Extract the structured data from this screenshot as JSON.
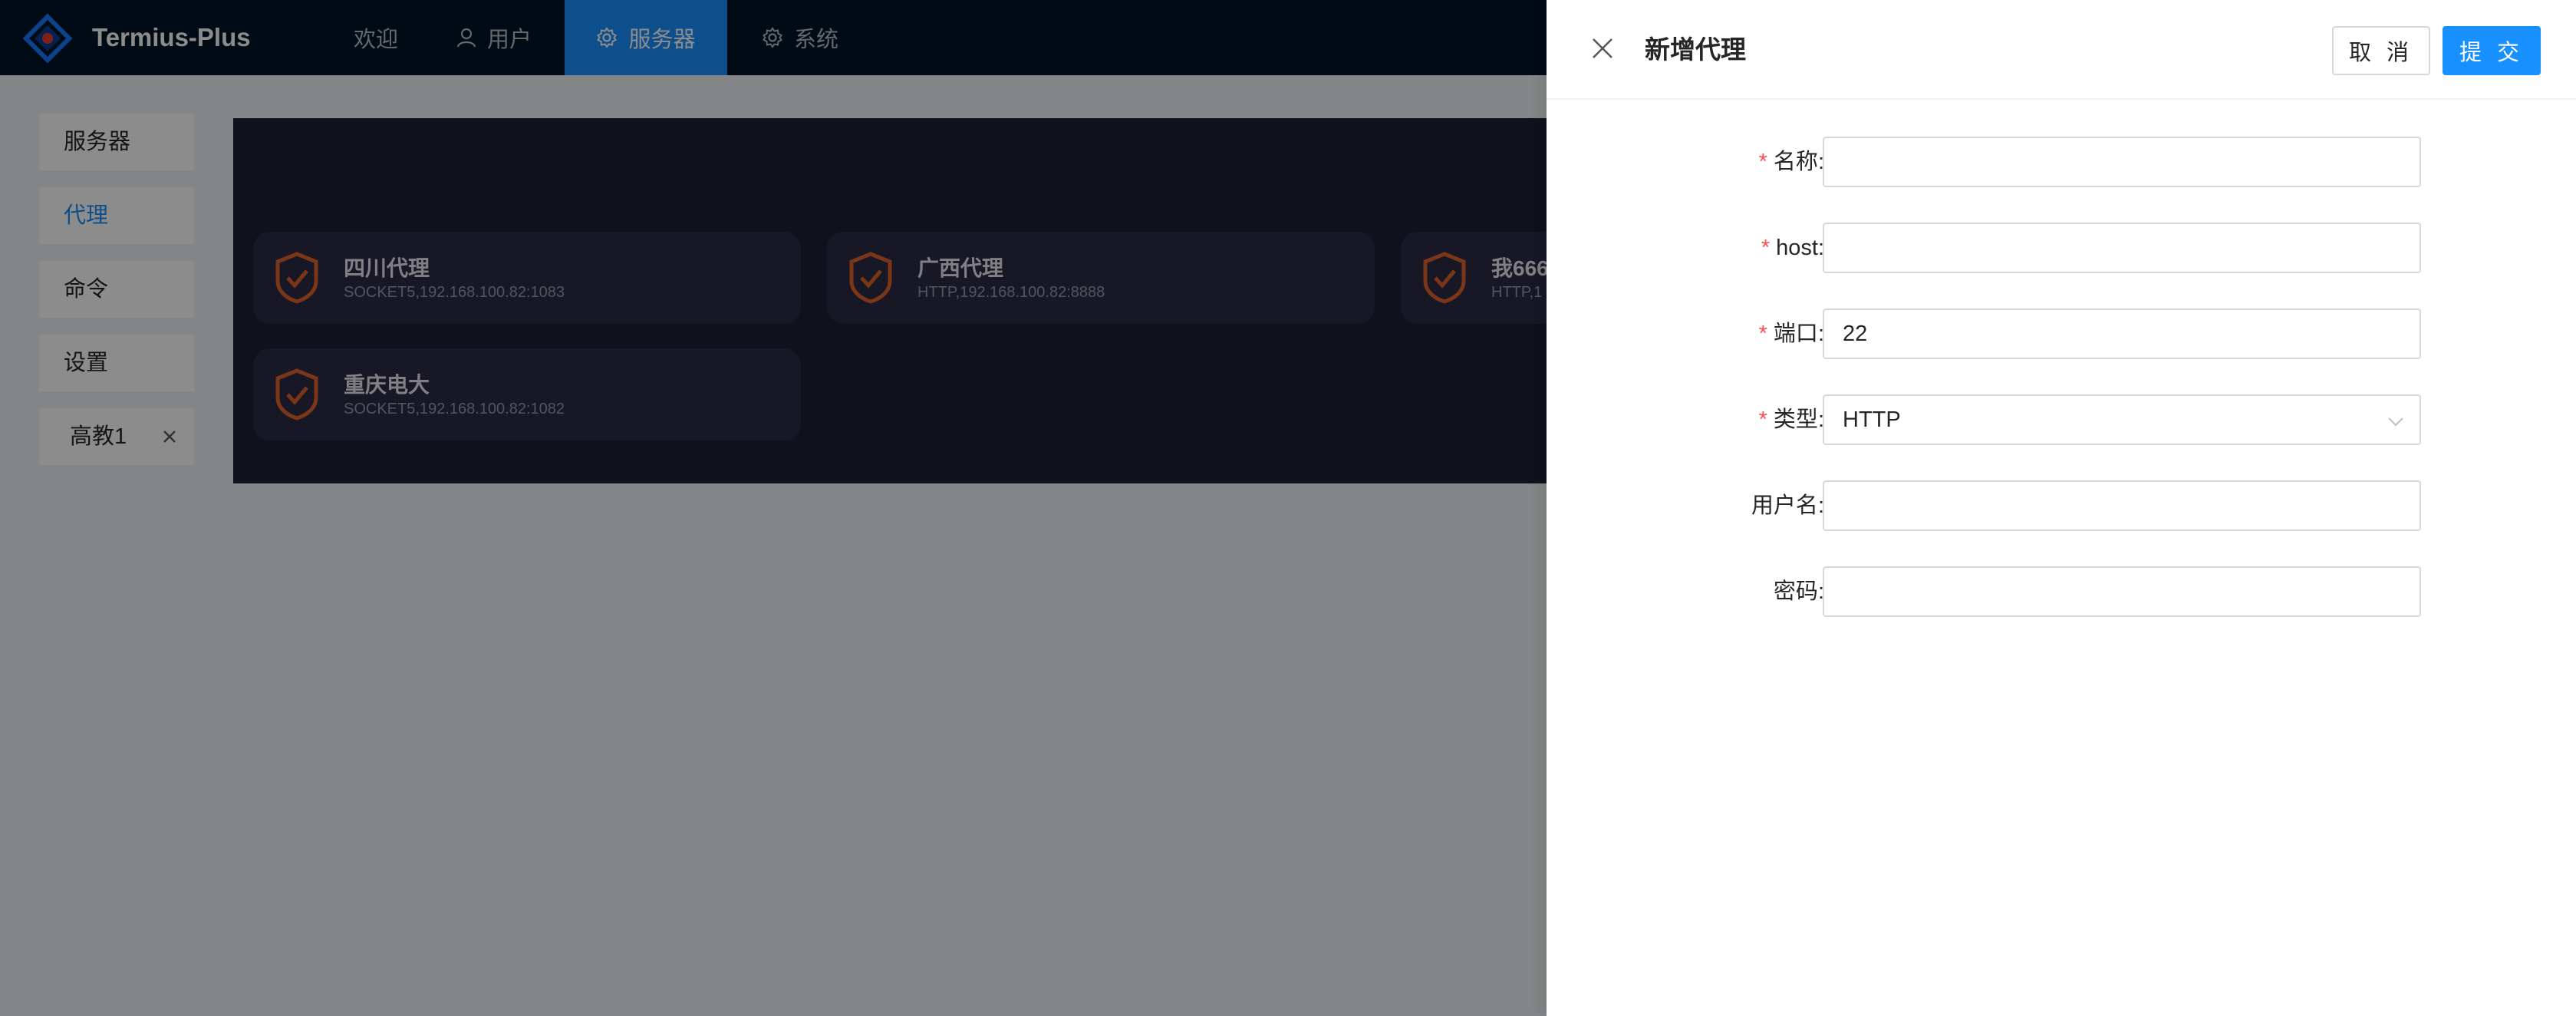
{
  "app": {
    "name": "Termius-Plus"
  },
  "nav": [
    {
      "label": "欢迎",
      "icon": "none"
    },
    {
      "label": "用户",
      "icon": "user-icon"
    },
    {
      "label": "服务器",
      "icon": "gear-icon",
      "active": true
    },
    {
      "label": "系统",
      "icon": "gear-icon"
    }
  ],
  "sidebar": {
    "items": [
      {
        "label": "服务器"
      },
      {
        "label": "代理",
        "active": true
      },
      {
        "label": "命令"
      },
      {
        "label": "设置"
      },
      {
        "label": "高教1",
        "closable": true
      }
    ]
  },
  "proxies": [
    {
      "name": "四川代理",
      "addr": "SOCKET5,192.168.100.82:1083"
    },
    {
      "name": "广西代理",
      "addr": "HTTP,192.168.100.82:8888"
    },
    {
      "name": "我666",
      "addr": "HTTP,1"
    },
    {
      "name": "重庆电大",
      "addr": "SOCKET5,192.168.100.82:1082"
    }
  ],
  "drawer": {
    "title": "新增代理",
    "cancel_label": "取 消",
    "submit_label": "提 交",
    "fields": {
      "name": {
        "label": "名称",
        "required": true,
        "value": ""
      },
      "host": {
        "label": "host",
        "required": true,
        "value": ""
      },
      "port": {
        "label": "端口",
        "required": true,
        "value": "22"
      },
      "type": {
        "label": "类型",
        "required": true,
        "value": "HTTP"
      },
      "username": {
        "label": "用户名",
        "required": false,
        "value": ""
      },
      "password": {
        "label": "密码",
        "required": false,
        "value": ""
      }
    },
    "colon": ":"
  },
  "colors": {
    "header": "#001529",
    "accent": "#1890ff",
    "required": "#ff4d4f",
    "shield": "#e0622b"
  }
}
